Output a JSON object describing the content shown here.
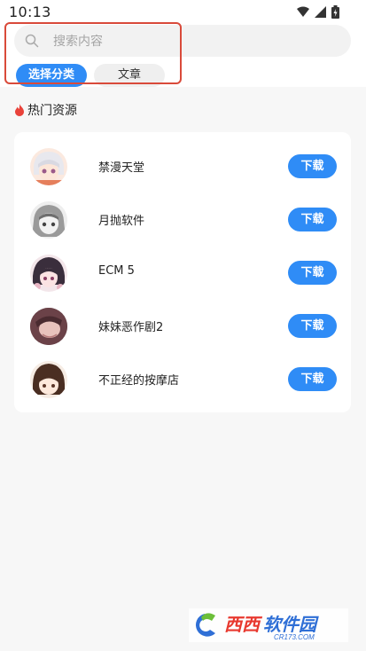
{
  "status_bar": {
    "time": "10:13",
    "icons": [
      "wifi-icon",
      "cell-signal-icon",
      "battery-icon"
    ]
  },
  "search": {
    "placeholder": "搜索内容"
  },
  "tabs": [
    {
      "label": "选择分类",
      "active": true
    },
    {
      "label": "文章",
      "active": false
    }
  ],
  "section": {
    "title": "热门资源",
    "icon": "flame-icon"
  },
  "resources": [
    {
      "title": "禁漫天堂",
      "button": "下载"
    },
    {
      "title": "月抛软件",
      "button": "下载"
    },
    {
      "title": "ECM 5",
      "button": "下载"
    },
    {
      "title": "妹妹恶作剧2",
      "button": "下载"
    },
    {
      "title": "不正经的按摩店",
      "button": "下载"
    }
  ],
  "watermark": {
    "brand": "西西软件园",
    "domain": "CR173.COM"
  },
  "colors": {
    "accent": "#2f8cf6",
    "highlight": "#d94a3a",
    "flame": "#e9423a"
  }
}
